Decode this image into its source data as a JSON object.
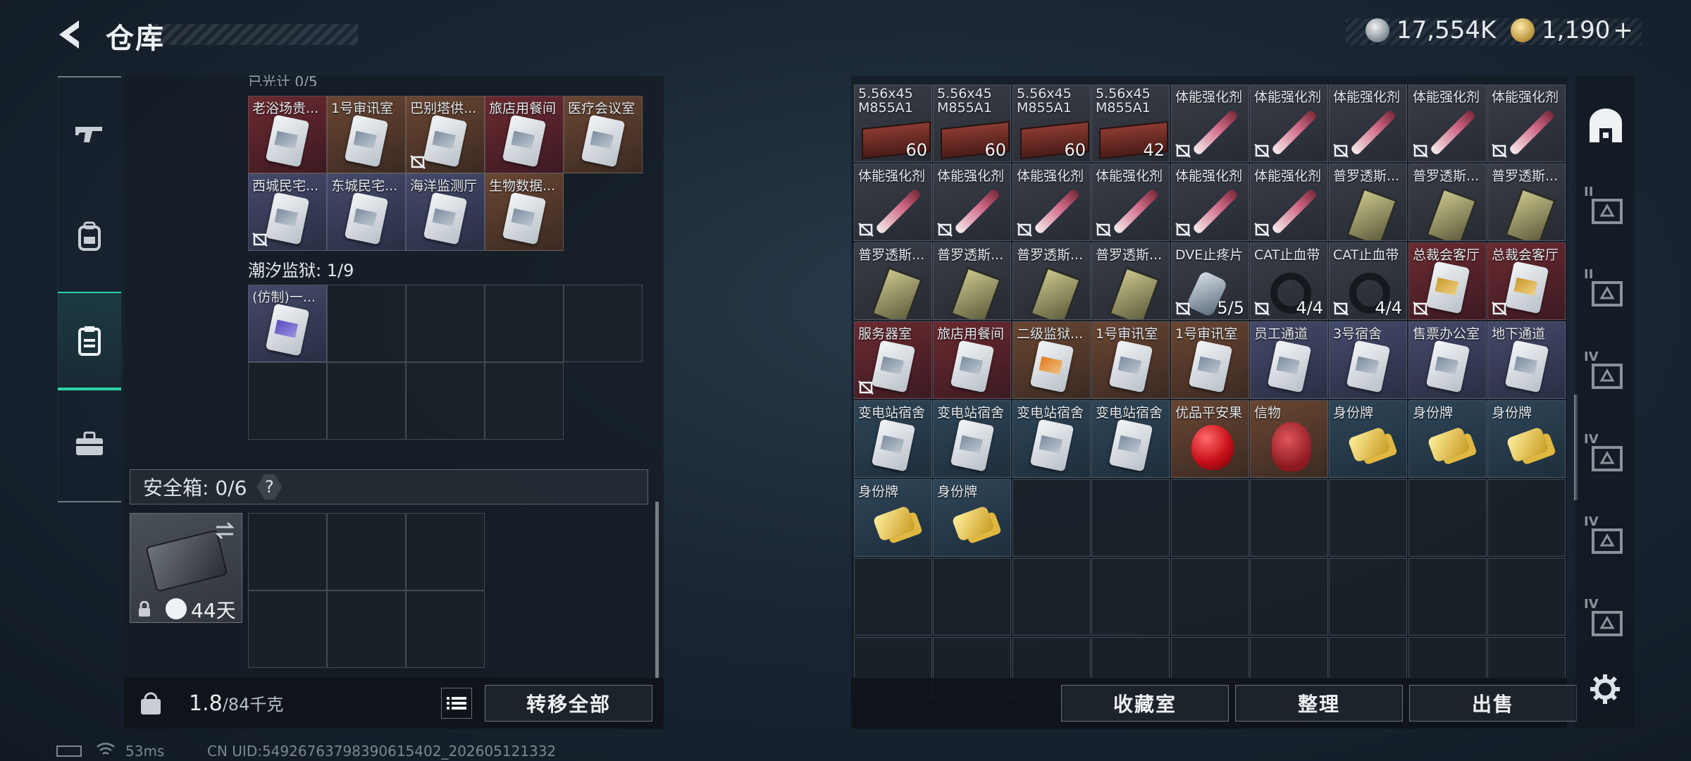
{
  "header": {
    "title": "仓库",
    "currency": [
      {
        "icon": "silver-coin-icon",
        "value": "17,554K"
      },
      {
        "icon": "gold-coin-icon",
        "value": "1,190"
      }
    ],
    "add_label": "+"
  },
  "nav": {
    "items": [
      {
        "name": "weapons",
        "icon": "gun-icon"
      },
      {
        "name": "gear",
        "icon": "backpack-icon"
      },
      {
        "name": "warehouse",
        "icon": "clipboard-icon",
        "active": true
      },
      {
        "name": "toolbox",
        "icon": "toolbox-icon"
      }
    ]
  },
  "left": {
    "partial_header": "已光计 0/5",
    "row1": [
      {
        "label": "老浴场贵...",
        "color": "red"
      },
      {
        "label": "1号审讯室",
        "color": "orange"
      },
      {
        "label": "巴别塔供...",
        "color": "orange",
        "flag": true
      },
      {
        "label": "旅店用餐间",
        "color": "red"
      },
      {
        "label": "医疗会议室",
        "color": "orange"
      }
    ],
    "row2": [
      {
        "label": "西城民宅...",
        "color": "purple",
        "flag": true
      },
      {
        "label": "东城民宅...",
        "color": "purple"
      },
      {
        "label": "海洋监测厅",
        "color": "purple"
      },
      {
        "label": "生物数据...",
        "color": "orange"
      }
    ],
    "section_tide": "潮汐监狱: 1/9",
    "tide_item": {
      "label": "(仿制)一...",
      "color": "purple"
    },
    "safebox_label": "安全箱: 0/6",
    "help": "?",
    "safebox_days": "44天",
    "weight_value": "1.8",
    "weight_max": "/84千克",
    "transfer_all": "转移全部"
  },
  "right": {
    "rows": [
      [
        {
          "label": "5.56x45",
          "label2": "M855A1",
          "count": "60",
          "art": "ammo",
          "color": "gray"
        },
        {
          "label": "5.56x45",
          "label2": "M855A1",
          "count": "60",
          "art": "ammo",
          "color": "gray"
        },
        {
          "label": "5.56x45",
          "label2": "M855A1",
          "count": "60",
          "art": "ammo",
          "color": "gray"
        },
        {
          "label": "5.56x45",
          "label2": "M855A1",
          "count": "42",
          "art": "ammo",
          "color": "gray"
        },
        {
          "label": "体能强化剂",
          "art": "syringe",
          "color": "gray",
          "flag": true
        },
        {
          "label": "体能强化剂",
          "art": "syringe",
          "color": "gray",
          "flag": true
        },
        {
          "label": "体能强化剂",
          "art": "syringe",
          "color": "gray",
          "flag": true
        },
        {
          "label": "体能强化剂",
          "art": "syringe",
          "color": "gray",
          "flag": true
        },
        {
          "label": "体能强化剂",
          "art": "syringe",
          "color": "gray",
          "flag": true
        }
      ],
      [
        {
          "label": "体能强化剂",
          "art": "syringe",
          "color": "gray",
          "flag": true
        },
        {
          "label": "体能强化剂",
          "art": "syringe",
          "color": "gray",
          "flag": true
        },
        {
          "label": "体能强化剂",
          "art": "syringe",
          "color": "gray",
          "flag": true
        },
        {
          "label": "体能强化剂",
          "art": "syringe",
          "color": "gray",
          "flag": true
        },
        {
          "label": "体能强化剂",
          "art": "syringe",
          "color": "gray",
          "flag": true
        },
        {
          "label": "体能强化剂",
          "art": "syringe",
          "color": "gray",
          "flag": true
        },
        {
          "label": "普罗透斯...",
          "art": "battery",
          "color": "gray"
        },
        {
          "label": "普罗透斯...",
          "art": "battery",
          "color": "gray"
        },
        {
          "label": "普罗透斯...",
          "art": "battery",
          "color": "gray"
        }
      ],
      [
        {
          "label": "普罗透斯...",
          "art": "battery",
          "color": "gray"
        },
        {
          "label": "普罗透斯...",
          "art": "battery",
          "color": "gray"
        },
        {
          "label": "普罗透斯...",
          "art": "battery",
          "color": "gray"
        },
        {
          "label": "普罗透斯...",
          "art": "battery",
          "color": "gray"
        },
        {
          "label": "DVE止疼片",
          "art": "pill",
          "color": "gray",
          "count": "5/5",
          "flag": true
        },
        {
          "label": "CAT止血带",
          "art": "band",
          "color": "gray",
          "count": "4/4",
          "flag": true
        },
        {
          "label": "CAT止血带",
          "art": "band",
          "color": "gray",
          "count": "4/4",
          "flag": true
        },
        {
          "label": "总裁会客厅",
          "art": "keycard-gold",
          "color": "red",
          "flag": true
        },
        {
          "label": "总裁会客厅",
          "art": "keycard-gold",
          "color": "red",
          "flag": true
        }
      ],
      [
        {
          "label": "服务器室",
          "art": "keycard",
          "color": "red",
          "flag": true
        },
        {
          "label": "旅店用餐间",
          "art": "keycard",
          "color": "red"
        },
        {
          "label": "二级监狱...",
          "art": "keycard-orange",
          "color": "orange"
        },
        {
          "label": "1号审讯室",
          "art": "keycard",
          "color": "orange"
        },
        {
          "label": "1号审讯室",
          "art": "keycard",
          "color": "orange"
        },
        {
          "label": "员工通道",
          "art": "keycard",
          "color": "purple"
        },
        {
          "label": "3号宿舍",
          "art": "keycard",
          "color": "purple"
        },
        {
          "label": "售票办公室",
          "art": "keycard",
          "color": "purple"
        },
        {
          "label": "地下通道",
          "art": "keycard",
          "color": "purple"
        }
      ],
      [
        {
          "label": "变电站宿舍",
          "art": "keycard",
          "color": "blue"
        },
        {
          "label": "变电站宿舍",
          "art": "keycard",
          "color": "blue"
        },
        {
          "label": "变电站宿舍",
          "art": "keycard",
          "color": "blue"
        },
        {
          "label": "变电站宿舍",
          "art": "keycard",
          "color": "blue"
        },
        {
          "label": "优品平安果",
          "art": "apple",
          "color": "orange"
        },
        {
          "label": "信物",
          "art": "skull",
          "color": "orange"
        },
        {
          "label": "身份牌",
          "art": "dogtag",
          "color": "blue"
        },
        {
          "label": "身份牌",
          "art": "dogtag",
          "color": "blue"
        },
        {
          "label": "身份牌",
          "art": "dogtag",
          "color": "blue"
        }
      ],
      [
        {
          "label": "身份牌",
          "art": "dogtag",
          "color": "blue"
        },
        {
          "label": "身份牌",
          "art": "dogtag",
          "color": "blue"
        }
      ]
    ],
    "buttons": {
      "collection": "收藏室",
      "sort": "整理",
      "sell": "出售"
    }
  },
  "side": {
    "labels": [
      "II",
      "II",
      "IV",
      "IV",
      "IV",
      "IV"
    ]
  },
  "status": {
    "ping": "53ms",
    "uid": "CN UID:54926763798390615402_202605121332"
  },
  "colors": {
    "accent": "#2bd4a8",
    "red_bg": "#6b2a30",
    "orange_bg": "#6a4632",
    "purple_bg": "#444a6a",
    "blue_bg": "#2e4658"
  }
}
